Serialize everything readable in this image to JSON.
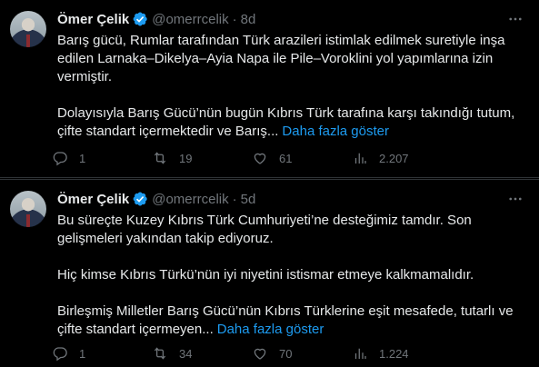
{
  "tweets": [
    {
      "author_name": "Ömer Çelik",
      "handle": "@omerrcelik",
      "separator": "·",
      "time": "8d",
      "paragraphs": [
        "Barış gücü, Rumlar tarafından Türk arazileri istimlak edilmek suretiyle inşa edilen Larnaka–Dikelya–Ayia Napa ile Pile–Voroklini yol yapımlarına izin vermiştir.",
        "Dolayısıyla Barış Gücü’nün bugün Kıbrıs Türk tarafına karşı takındığı tutum, çifte standart içermektedir ve Barış..."
      ],
      "show_more": "Daha fazla göster",
      "replies": "1",
      "retweets": "19",
      "likes": "61",
      "views": "2.207"
    },
    {
      "author_name": "Ömer Çelik",
      "handle": "@omerrcelik",
      "separator": "·",
      "time": "5d",
      "paragraphs": [
        "Bu süreçte Kuzey Kıbrıs Türk Cumhuriyeti’ne desteğimiz tamdır. Son gelişmeleri yakından takip ediyoruz.",
        "Hiç kimse Kıbrıs Türkü’nün iyi niyetini istismar etmeye kalkmamalıdır.",
        "Birleşmiş Milletler Barış Gücü’nün Kıbrıs Türklerine eşit mesafede, tutarlı ve çifte standart içermeyen..."
      ],
      "show_more": "Daha fazla göster",
      "replies": "1",
      "retweets": "34",
      "likes": "70",
      "views": "1.224"
    }
  ],
  "colors": {
    "background": "#000000",
    "text": "#e7e9ea",
    "muted": "#71767b",
    "link": "#1d9bf0",
    "verified": "#1d9bf0",
    "divider": "#2f3336"
  },
  "icons": [
    "more-icon",
    "verified-badge-icon",
    "reply-icon",
    "retweet-icon",
    "like-icon",
    "views-icon"
  ]
}
